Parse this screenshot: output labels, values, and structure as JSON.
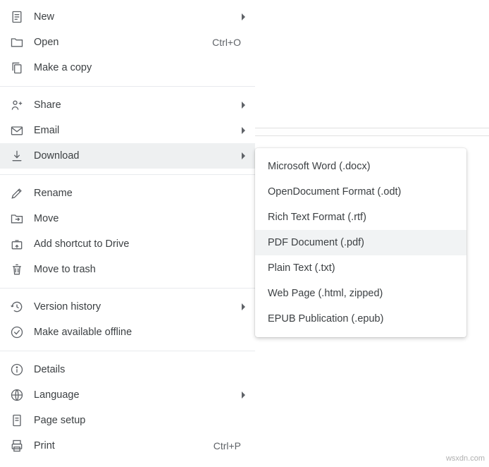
{
  "menu": {
    "groups": [
      [
        {
          "key": "new",
          "label": "New",
          "icon": "doc-icon",
          "submenu": true
        },
        {
          "key": "open",
          "label": "Open",
          "icon": "folder-icon",
          "shortcut": "Ctrl+O"
        },
        {
          "key": "make-a-copy",
          "label": "Make a copy",
          "icon": "copy-icon"
        }
      ],
      [
        {
          "key": "share",
          "label": "Share",
          "icon": "share-icon",
          "submenu": true
        },
        {
          "key": "email",
          "label": "Email",
          "icon": "email-icon",
          "submenu": true
        },
        {
          "key": "download",
          "label": "Download",
          "icon": "download-icon",
          "submenu": true,
          "highlight": true
        }
      ],
      [
        {
          "key": "rename",
          "label": "Rename",
          "icon": "rename-icon"
        },
        {
          "key": "move",
          "label": "Move",
          "icon": "move-icon"
        },
        {
          "key": "add-shortcut",
          "label": "Add shortcut to Drive",
          "icon": "shortcut-icon"
        },
        {
          "key": "move-to-trash",
          "label": "Move to trash",
          "icon": "trash-icon"
        }
      ],
      [
        {
          "key": "version-history",
          "label": "Version history",
          "icon": "history-icon",
          "submenu": true
        },
        {
          "key": "available-offline",
          "label": "Make available offline",
          "icon": "offline-icon"
        }
      ],
      [
        {
          "key": "details",
          "label": "Details",
          "icon": "info-icon"
        },
        {
          "key": "language",
          "label": "Language",
          "icon": "language-icon",
          "submenu": true
        },
        {
          "key": "page-setup",
          "label": "Page setup",
          "icon": "page-setup-icon"
        },
        {
          "key": "print",
          "label": "Print",
          "icon": "print-icon",
          "shortcut": "Ctrl+P"
        }
      ]
    ]
  },
  "download_submenu": [
    {
      "key": "docx",
      "label": "Microsoft Word (.docx)"
    },
    {
      "key": "odt",
      "label": "OpenDocument Format (.odt)"
    },
    {
      "key": "rtf",
      "label": "Rich Text Format (.rtf)"
    },
    {
      "key": "pdf",
      "label": "PDF Document (.pdf)",
      "highlight": true
    },
    {
      "key": "txt",
      "label": "Plain Text (.txt)"
    },
    {
      "key": "html",
      "label": "Web Page (.html, zipped)"
    },
    {
      "key": "epub",
      "label": "EPUB Publication (.epub)"
    }
  ],
  "watermark": "wsxdn.com"
}
